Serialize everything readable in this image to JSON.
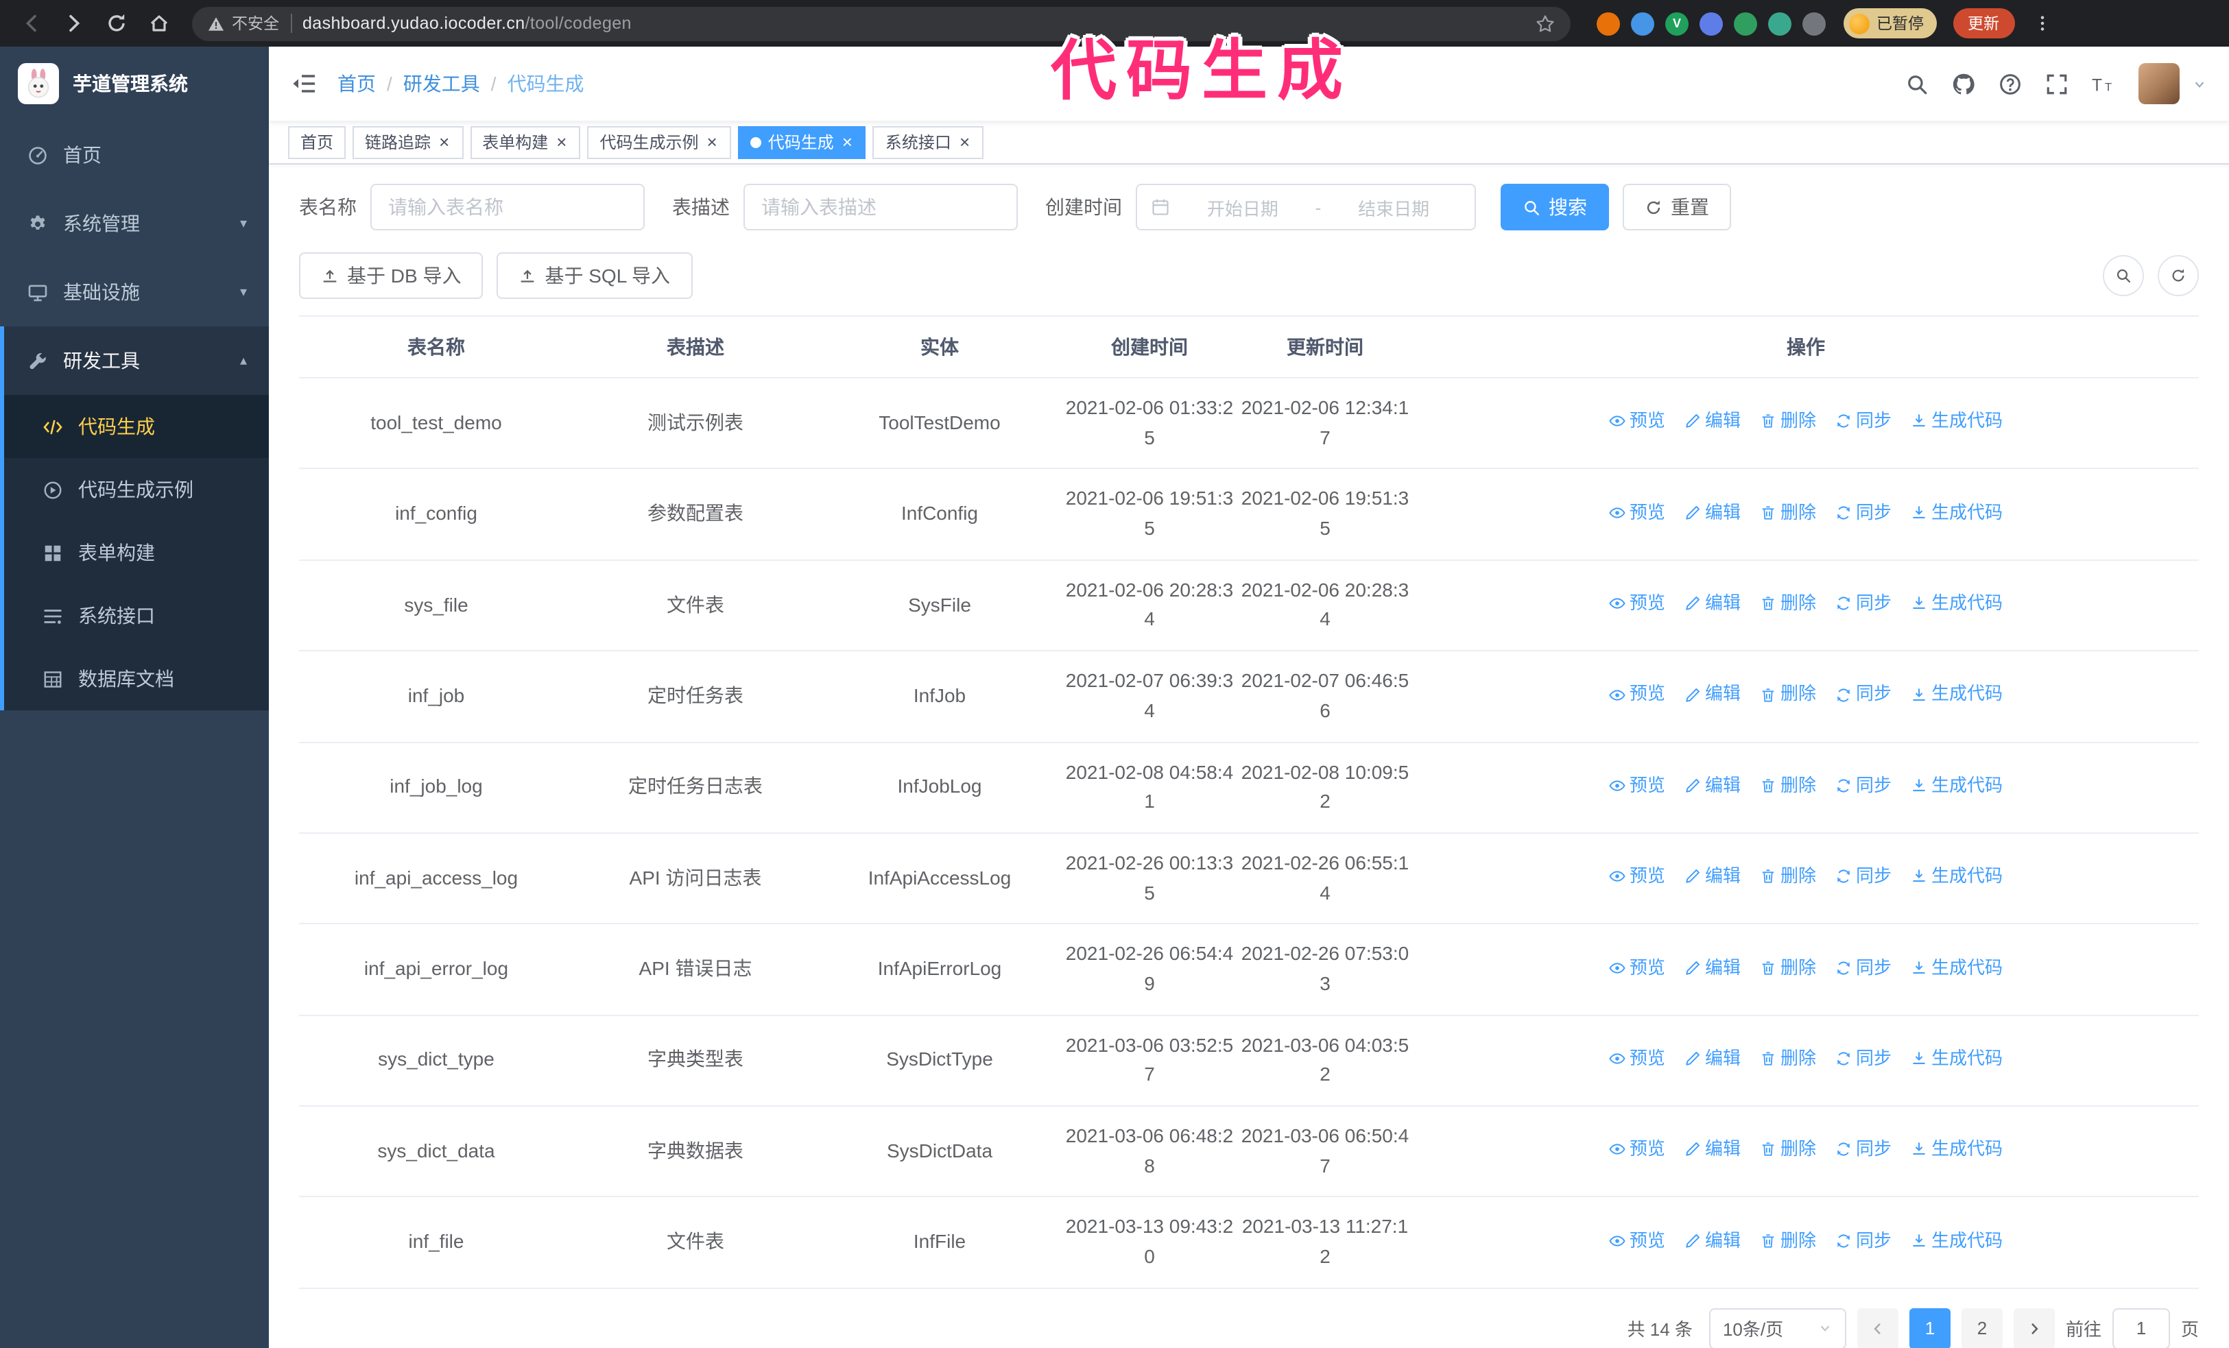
{
  "browser": {
    "security_label": "不安全",
    "url_domain": "dashboard.yudao.iocoder.cn",
    "url_path": "/tool/codegen",
    "paused_badge": "已暂停",
    "update_button": "更新",
    "extensions": [
      {
        "name": "orange",
        "color": "#e8710a"
      },
      {
        "name": "blue-drop",
        "color": "#4596e6"
      },
      {
        "name": "green-v",
        "color": "#1fa05c",
        "glyph": "V"
      },
      {
        "name": "people",
        "color": "#5f7de8"
      },
      {
        "name": "green-box",
        "color": "#2f9e5f"
      },
      {
        "name": "teal",
        "color": "#3aa88f"
      },
      {
        "name": "puzzle",
        "color": "#73777d"
      }
    ]
  },
  "annotation": {
    "text": "代码生成",
    "color": "#ff2d78"
  },
  "sidebar": {
    "logo_title": "芋道管理系统",
    "items": [
      {
        "id": "home",
        "icon": "dashboard",
        "label": "首页"
      },
      {
        "id": "system-mgmt",
        "icon": "gear",
        "label": "系统管理",
        "expandable": true,
        "expanded": false
      },
      {
        "id": "infrastructure",
        "icon": "monitor",
        "label": "基础设施",
        "expandable": true,
        "expanded": false
      },
      {
        "id": "dev-tools",
        "icon": "tools",
        "label": "研发工具",
        "expandable": true,
        "expanded": true,
        "children": [
          {
            "id": "codegen",
            "icon": "code",
            "label": "代码生成",
            "active": true
          },
          {
            "id": "codegen-example",
            "icon": "example",
            "label": "代码生成示例"
          },
          {
            "id": "form-builder",
            "icon": "grid",
            "label": "表单构建"
          },
          {
            "id": "system-api",
            "icon": "api",
            "label": "系统接口"
          },
          {
            "id": "db-doc",
            "icon": "dbdoc",
            "label": "数据库文档"
          }
        ]
      }
    ]
  },
  "header": {
    "separator": "/",
    "breadcrumb": [
      "首页",
      "研发工具",
      "代码生成"
    ]
  },
  "tabs": [
    {
      "id": "home",
      "label": "首页",
      "closable": false
    },
    {
      "id": "trace",
      "label": "链路追踪",
      "closable": true
    },
    {
      "id": "form-builder",
      "label": "表单构建",
      "closable": true
    },
    {
      "id": "codegen-example",
      "label": "代码生成示例",
      "closable": true
    },
    {
      "id": "codegen",
      "label": "代码生成",
      "closable": true,
      "active": true
    },
    {
      "id": "system-api",
      "label": "系统接口",
      "closable": true
    }
  ],
  "filters": {
    "table_name_label": "表名称",
    "table_name_placeholder": "请输入表名称",
    "table_desc_label": "表描述",
    "table_desc_placeholder": "请输入表描述",
    "create_time_label": "创建时间",
    "date_start_placeholder": "开始日期",
    "date_separator": "-",
    "date_end_placeholder": "结束日期",
    "search_button": "搜索",
    "reset_button": "重置"
  },
  "toolbar": {
    "import_db": "基于 DB 导入",
    "import_sql": "基于 SQL 导入"
  },
  "table": {
    "columns": [
      "表名称",
      "表描述",
      "实体",
      "创建时间",
      "更新时间",
      "操作"
    ],
    "actions": [
      {
        "id": "preview",
        "icon": "eye",
        "label": "预览"
      },
      {
        "id": "edit",
        "icon": "pencil",
        "label": "编辑"
      },
      {
        "id": "delete",
        "icon": "trash",
        "label": "删除"
      },
      {
        "id": "sync",
        "icon": "sync",
        "label": "同步"
      },
      {
        "id": "generate",
        "icon": "download",
        "label": "生成代码"
      }
    ],
    "rows": [
      {
        "name": "tool_test_demo",
        "desc": "测试示例表",
        "entity": "ToolTestDemo",
        "created": "2021-02-06 01:33:25",
        "updated": "2021-02-06 12:34:17"
      },
      {
        "name": "inf_config",
        "desc": "参数配置表",
        "entity": "InfConfig",
        "created": "2021-02-06 19:51:35",
        "updated": "2021-02-06 19:51:35"
      },
      {
        "name": "sys_file",
        "desc": "文件表",
        "entity": "SysFile",
        "created": "2021-02-06 20:28:34",
        "updated": "2021-02-06 20:28:34"
      },
      {
        "name": "inf_job",
        "desc": "定时任务表",
        "entity": "InfJob",
        "created": "2021-02-07 06:39:34",
        "updated": "2021-02-07 06:46:56"
      },
      {
        "name": "inf_job_log",
        "desc": "定时任务日志表",
        "entity": "InfJobLog",
        "created": "2021-02-08 04:58:41",
        "updated": "2021-02-08 10:09:52"
      },
      {
        "name": "inf_api_access_log",
        "desc": "API 访问日志表",
        "entity": "InfApiAccessLog",
        "created": "2021-02-26 00:13:35",
        "updated": "2021-02-26 06:55:14"
      },
      {
        "name": "inf_api_error_log",
        "desc": "API 错误日志",
        "entity": "InfApiErrorLog",
        "created": "2021-02-26 06:54:49",
        "updated": "2021-02-26 07:53:03"
      },
      {
        "name": "sys_dict_type",
        "desc": "字典类型表",
        "entity": "SysDictType",
        "created": "2021-03-06 03:52:57",
        "updated": "2021-03-06 04:03:52"
      },
      {
        "name": "sys_dict_data",
        "desc": "字典数据表",
        "entity": "SysDictData",
        "created": "2021-03-06 06:48:28",
        "updated": "2021-03-06 06:50:47"
      },
      {
        "name": "inf_file",
        "desc": "文件表",
        "entity": "InfFile",
        "created": "2021-03-13 09:43:20",
        "updated": "2021-03-13 11:27:12"
      }
    ]
  },
  "pagination": {
    "total": "共 14 条",
    "page_size": "10条/页",
    "pages": [
      "1",
      "2"
    ],
    "active_page": "1",
    "goto_label": "前往",
    "goto_value": "1",
    "page_label": "页"
  },
  "colors": {
    "primary": "#409eff",
    "sidebar_bg": "#304156",
    "submenu_bg": "#1f2d3d",
    "active_menu_text": "#ffd04b"
  }
}
